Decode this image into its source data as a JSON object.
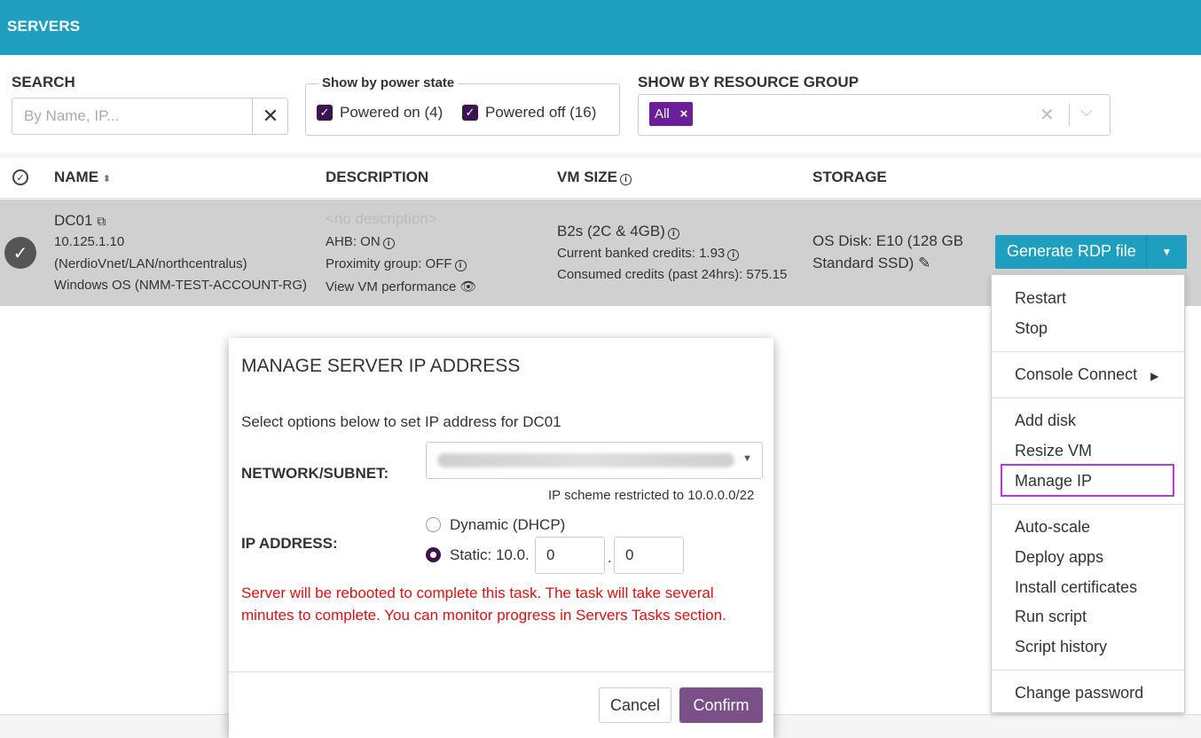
{
  "header": {
    "title": "SERVERS",
    "color": "#1f9fc0"
  },
  "filters": {
    "search_label": "SEARCH",
    "search_placeholder": "By Name, IP...",
    "power_legend": "Show by power state",
    "powered_on": "Powered on (4)",
    "powered_off": "Powered off (16)",
    "resource_group_label": "SHOW BY RESOURCE GROUP",
    "resource_group_tag": "All"
  },
  "table": {
    "columns": {
      "name": "NAME",
      "description": "DESCRIPTION",
      "vm_size": "VM SIZE",
      "storage": "STORAGE"
    },
    "row": {
      "name": "DC01",
      "ip": "10.125.1.10",
      "network": "(NerdioVnet/LAN/northcentralus)",
      "os": "Windows OS (NMM-TEST-ACCOUNT-RG)",
      "description": "<no description>",
      "ahb": "AHB: ON",
      "proximity": "Proximity group: OFF",
      "view_perf": "View VM performance",
      "vm_size": "B2s (2C & 4GB)",
      "banked": "Current banked credits: 1.93",
      "consumed": "Consumed credits (past 24hrs): 575.15",
      "storage_1": "OS Disk: E10 (128 GB",
      "storage_2": "Standard SSD)"
    }
  },
  "actions": {
    "generate_rdp": "Generate RDP file",
    "menu": {
      "restart": "Restart",
      "stop": "Stop",
      "console_connect": "Console Connect",
      "add_disk": "Add disk",
      "resize_vm": "Resize VM",
      "manage_ip": "Manage IP",
      "auto_scale": "Auto-scale",
      "deploy_apps": "Deploy apps",
      "install_certificates": "Install certificates",
      "run_script": "Run script",
      "script_history": "Script history",
      "change_password": "Change password"
    }
  },
  "modal": {
    "title": "MANAGE SERVER IP ADDRESS",
    "intro": "Select options below to set IP address for DC01",
    "network_label": "NETWORK/SUBNET:",
    "ip_scheme": "IP scheme restricted to 10.0.0.0/22",
    "ip_label": "IP ADDRESS:",
    "dynamic": "Dynamic (DHCP)",
    "static_prefix": "Static: 10.0.",
    "octet3": "0",
    "octet4": "0",
    "warning": "Server will be rebooted to complete this task. The task will take several minutes to complete. You can monitor progress in Servers Tasks section.",
    "cancel": "Cancel",
    "confirm": "Confirm"
  }
}
